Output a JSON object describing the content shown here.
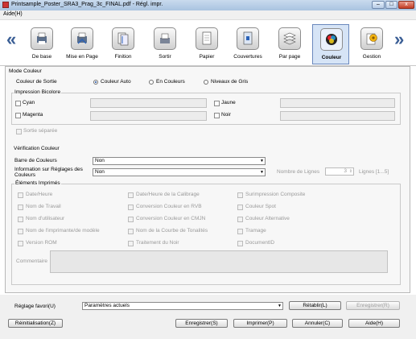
{
  "window": {
    "title": "Printsample_Poster_SRA3_Prag_3c_FINAL.pdf - Régl. impr.",
    "minimize": "–",
    "maximize": "□",
    "close": "x"
  },
  "menu": {
    "aide": "Aide(H)"
  },
  "toolbar": {
    "prev_arrow": "«",
    "next_arrow": "»",
    "items": [
      {
        "label": "De base",
        "icon": "basic-settings-icon"
      },
      {
        "label": "Mise en Page",
        "icon": "layout-icon"
      },
      {
        "label": "Finition",
        "icon": "finishing-icon"
      },
      {
        "label": "Sortir",
        "icon": "output-tray-icon"
      },
      {
        "label": "Papier",
        "icon": "paper-icon"
      },
      {
        "label": "Couvertures",
        "icon": "cover-icon"
      },
      {
        "label": "Par page",
        "icon": "per-page-icon"
      },
      {
        "label": "Couleur",
        "icon": "color-icon",
        "active": true
      },
      {
        "label": "Gestion",
        "icon": "management-icon"
      }
    ]
  },
  "mode_couleur": {
    "title": "Mode Couleur",
    "label": "Couleur de Sortie",
    "options": [
      "Couleur Auto",
      "En Couleurs",
      "Niveaux de Gris"
    ],
    "selected": "Couleur Auto"
  },
  "bicolore": {
    "title": "Impression Bicolore",
    "cyan": "Cyan",
    "jaune": "Jaune",
    "magenta": "Magenta",
    "noir": "Noir",
    "sortie_separee": "Sortie séparée"
  },
  "verification": {
    "title": "Vérification Couleur",
    "barre_label": "Barre de Couleurs",
    "barre_value": "Non",
    "info_label": "Information sur Réglages des Couleurs",
    "info_value": "Non",
    "nombre_label": "Nombre de Lignes",
    "nombre_value": "3",
    "lignes_label": "Lignes [1...5]"
  },
  "elements": {
    "title": "Éléments Imprimés",
    "col1": [
      "Date/Heure",
      "Nom de Travail",
      "Nom d'utilisateur",
      "Nom de l'imprimante/de modèle",
      "Version ROM"
    ],
    "col2": [
      "Date/Heure de la Calibrage",
      "Conversion Couleur en RVB",
      "Conversion Couleur en CMJN",
      "Nom de la Courbe de Tonalités",
      "Traitement du Noir"
    ],
    "col3": [
      "Surimpression Composite",
      "Couleur Spot",
      "Couleur Alternative",
      "Tramage",
      "DocumentID"
    ],
    "commentaire": "Commentaire"
  },
  "bottom": {
    "reglage_label": "Réglage favori(U)",
    "reglage_value": "Paramètres actuels",
    "retablir": "Rétablir(L)",
    "enregistrer_r": "Enregistrer(R)",
    "reinitialisation": "Réinitialisation(Z)",
    "enregistrer_s": "Enregistrer(S)",
    "imprimer": "Imprimer(P)",
    "annuler": "Annuler(C)",
    "aide": "Aide(H)"
  },
  "colors": {
    "accent": "#1d4fa0",
    "arrow": "#3a5e95",
    "titlebar": "#b8cde6"
  }
}
